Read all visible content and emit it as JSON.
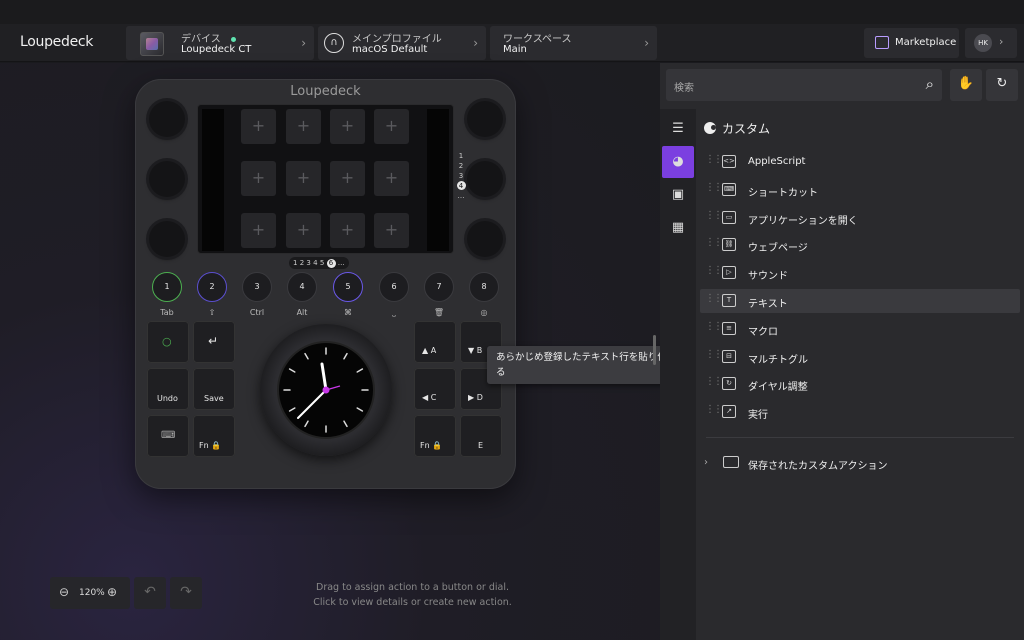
{
  "app": {
    "logo": "Loupedeck"
  },
  "topbar": {
    "device": {
      "label": "デバイス",
      "value": "Loupedeck CT",
      "status_color": "#5fe3b0"
    },
    "profile": {
      "label": "メインプロファイル",
      "value": "macOS Default"
    },
    "workspace": {
      "label": "ワークスペース",
      "value": "Main"
    },
    "marketplace": "Marketplace",
    "user_initials": "HK"
  },
  "device": {
    "logo": "Loupedeck",
    "page_numbers": [
      "1",
      "2",
      "3",
      "4",
      "…"
    ],
    "active_page": "4",
    "workspace_pages": [
      "1",
      "2",
      "3",
      "4",
      "5"
    ],
    "active_workspace_page": "6",
    "workspace_more": "…",
    "round_buttons": [
      {
        "num": "1",
        "label": "Tab",
        "ring": "#4caf50"
      },
      {
        "num": "2",
        "label": "⇧",
        "ring": "#5b4fd0"
      },
      {
        "num": "3",
        "label": "Ctrl",
        "ring": "#3a3a3e"
      },
      {
        "num": "4",
        "label": "Alt",
        "ring": "#3a3a3e"
      },
      {
        "num": "5",
        "label": "⌘",
        "ring": "#6a58e8"
      },
      {
        "num": "6",
        "label": "⎵",
        "ring": "#3a3a3e"
      },
      {
        "num": "7",
        "label": "🗑",
        "ring": "#3a3a3e"
      },
      {
        "num": "8",
        "label": "◎",
        "ring": "#3a3a3e"
      }
    ],
    "left_keys": [
      "○",
      "↵",
      "Undo",
      "Save",
      "⌨",
      "Fn 🔒"
    ],
    "right_keys": [
      "▲ A",
      "▼ B",
      "◀ C",
      "▶ D",
      "Fn 🔒",
      "E"
    ],
    "dial_accent": "#c837e8"
  },
  "tooltip": "あらかじめ登録したテキスト行を貼り付ける",
  "hint": "Drag to assign action to a button or dial.\nClick to view details or create new action.",
  "zoom": {
    "value": "120%"
  },
  "panel": {
    "search_placeholder": "検索",
    "category": "カスタム",
    "accent": "#7b3fe0",
    "items": [
      {
        "label": "AppleScript",
        "icon": "script-icon"
      },
      {
        "label": "ショートカット",
        "icon": "keyboard-icon"
      },
      {
        "label": "アプリケーションを開く",
        "icon": "app-window-icon"
      },
      {
        "label": "ウェブページ",
        "icon": "link-icon"
      },
      {
        "label": "サウンド",
        "icon": "play-icon"
      },
      {
        "label": "テキスト",
        "icon": "text-icon"
      },
      {
        "label": "マクロ",
        "icon": "macro-icon"
      },
      {
        "label": "マルチトグル",
        "icon": "multi-toggle-icon"
      },
      {
        "label": "ダイヤル調整",
        "icon": "rotate-icon"
      },
      {
        "label": "実行",
        "icon": "run-icon"
      }
    ],
    "highlighted_index": 5,
    "folder": "保存されたカスタムアクション"
  }
}
